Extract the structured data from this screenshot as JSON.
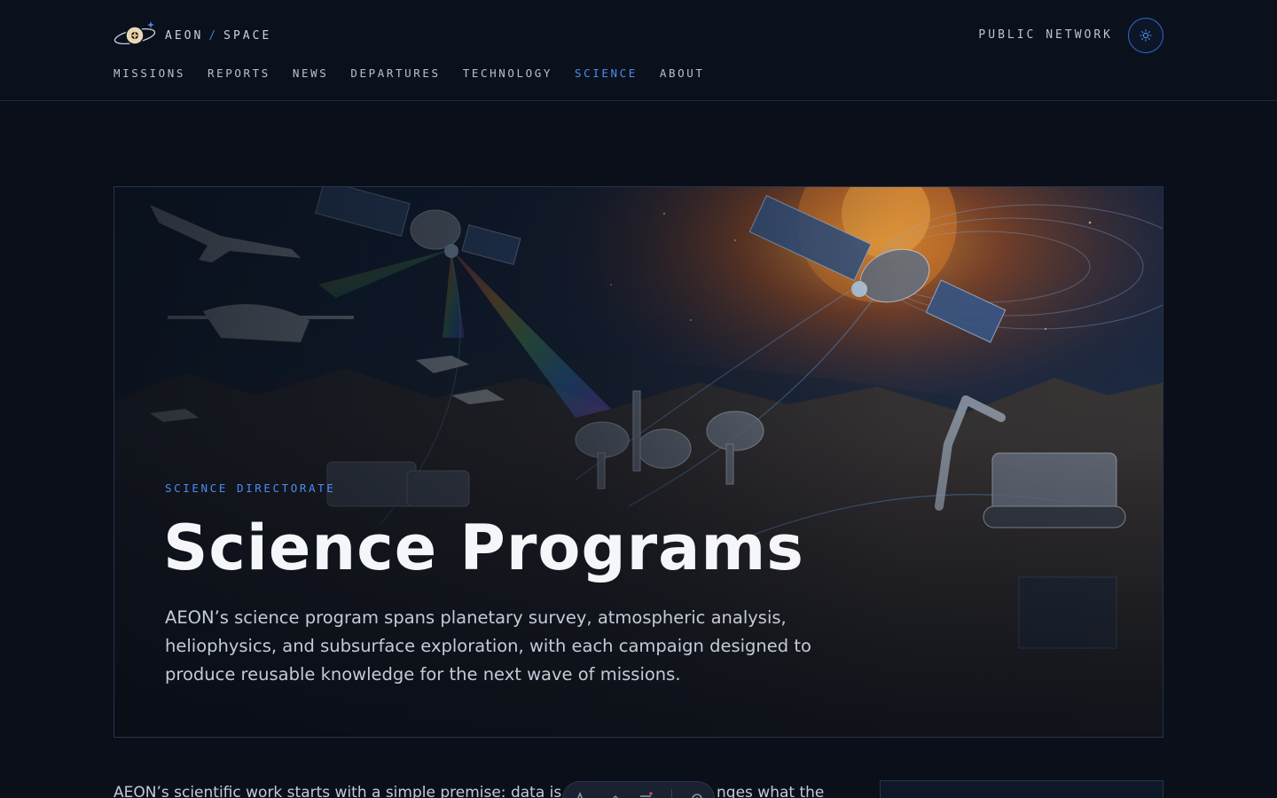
{
  "brand": {
    "name_left": "AEON",
    "separator": "/",
    "name_right": "SPACE",
    "icon": "planet-logo-icon"
  },
  "header": {
    "network_label": "PUBLIC NETWORK",
    "theme_icon": "sun-icon"
  },
  "nav": {
    "items": [
      {
        "label": "MISSIONS",
        "active": false
      },
      {
        "label": "REPORTS",
        "active": false
      },
      {
        "label": "NEWS",
        "active": false
      },
      {
        "label": "DEPARTURES",
        "active": false
      },
      {
        "label": "TECHNOLOGY",
        "active": false
      },
      {
        "label": "SCIENCE",
        "active": true
      },
      {
        "label": "ABOUT",
        "active": false
      }
    ]
  },
  "hero": {
    "eyebrow": "SCIENCE DIRECTORATE",
    "title": "Science Programs",
    "description": "AEON’s science program spans planetary survey, atmospheric analysis, heliophysics, and subsurface exploration, with each campaign designed to produce reusable knowledge for the next wave of missions."
  },
  "content": {
    "intro_start": "AEON’s scientific work starts with a simple premise: data is o",
    "intro_end": "nges what the"
  },
  "toolbar": {
    "icons": [
      "text-icon",
      "pen-icon",
      "list-icon",
      "settings-icon"
    ]
  },
  "colors": {
    "accent": "#4c8bf0",
    "background": "#0a0f1a",
    "border": "#26344a"
  }
}
